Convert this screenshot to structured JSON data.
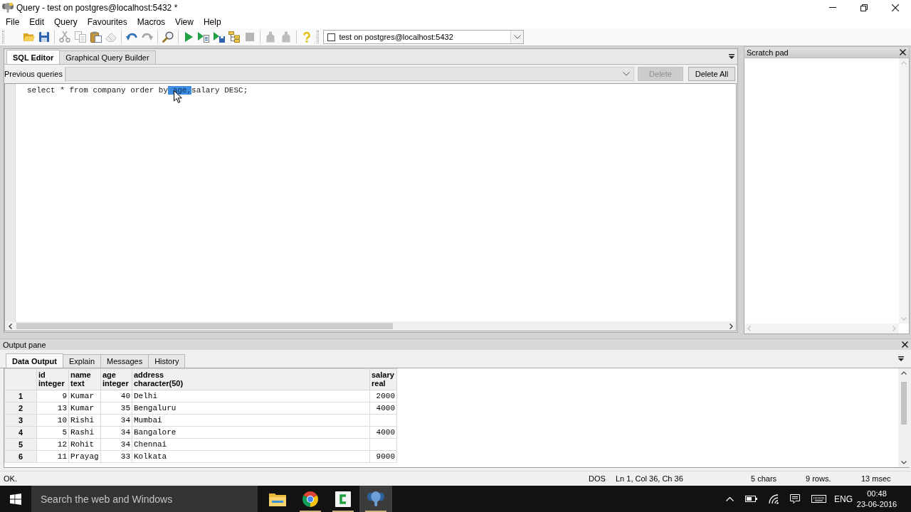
{
  "window": {
    "title": "Query - test on postgres@localhost:5432 *"
  },
  "menu": [
    "File",
    "Edit",
    "Query",
    "Favourites",
    "Macros",
    "View",
    "Help"
  ],
  "toolbar": {
    "tools": [
      {
        "kind": "open",
        "disabled": false
      },
      {
        "kind": "save",
        "disabled": false
      },
      {
        "kind": "separator"
      },
      {
        "kind": "cut",
        "disabled": true
      },
      {
        "kind": "copy",
        "disabled": true
      },
      {
        "kind": "paste",
        "disabled": false
      },
      {
        "kind": "clear",
        "disabled": true
      },
      {
        "kind": "separator"
      },
      {
        "kind": "undo",
        "disabled": false
      },
      {
        "kind": "redo",
        "disabled": true
      },
      {
        "kind": "separator"
      },
      {
        "kind": "find",
        "disabled": false
      },
      {
        "kind": "separator"
      },
      {
        "kind": "execute",
        "disabled": false
      },
      {
        "kind": "execute_pgscript",
        "disabled": false
      },
      {
        "kind": "execute_to_file",
        "disabled": false
      },
      {
        "kind": "explain",
        "disabled": false
      },
      {
        "kind": "cancel",
        "disabled": true
      },
      {
        "kind": "separator"
      },
      {
        "kind": "commit",
        "disabled": true
      },
      {
        "kind": "rollback",
        "disabled": true
      },
      {
        "kind": "separator"
      },
      {
        "kind": "help",
        "disabled": false
      }
    ],
    "connection": {
      "checked": false,
      "label": "test on postgres@localhost:5432"
    }
  },
  "editor": {
    "tabs": [
      {
        "label": "SQL Editor",
        "selected": true
      },
      {
        "label": "Graphical Query Builder",
        "selected": false
      }
    ],
    "previous_queries": {
      "label": "Previous queries"
    },
    "buttons": [
      {
        "label": "Delete",
        "disabled": true
      },
      {
        "label": "Delete All",
        "disabled": false
      }
    ],
    "lines": [
      {
        "segments": [
          {
            "text": "select * from company order by",
            "selected": false
          },
          {
            "text": " age,",
            "selected": true
          },
          {
            "text": "salary DESC;",
            "selected": false
          }
        ]
      }
    ]
  },
  "scratch_pad": {
    "title": "Scratch pad"
  },
  "output_pane": {
    "title": "Output pane",
    "tabs": [
      {
        "label": "Data Output",
        "selected": true
      },
      {
        "label": "Explain",
        "selected": false
      },
      {
        "label": "Messages",
        "selected": false
      },
      {
        "label": "History",
        "selected": false
      }
    ],
    "table": {
      "columns": [
        {
          "name": "id",
          "type": "integer",
          "numeric": true
        },
        {
          "name": "name",
          "type": "text",
          "numeric": false
        },
        {
          "name": "age",
          "type": "integer",
          "numeric": true
        },
        {
          "name": "address",
          "type": "character(50)",
          "numeric": false
        },
        {
          "name": "salary",
          "type": "real",
          "numeric": true
        }
      ],
      "rows": [
        {
          "number": "1",
          "cells": [
            "9",
            "Kumar",
            "40",
            "Delhi",
            "2000"
          ]
        },
        {
          "number": "2",
          "cells": [
            "13",
            "Kumar",
            "35",
            "Bengaluru",
            "4000"
          ]
        },
        {
          "number": "3",
          "cells": [
            "10",
            "Rishi",
            "34",
            "Mumbai",
            null
          ]
        },
        {
          "number": "4",
          "cells": [
            "5",
            "Rashi",
            "34",
            "Bangalore",
            "4000"
          ]
        },
        {
          "number": "5",
          "cells": [
            "12",
            "Rohit",
            "34",
            "Chennai",
            null
          ]
        },
        {
          "number": "6",
          "cells": [
            "11",
            "Prayag",
            "33",
            "Kolkata",
            "9000"
          ]
        }
      ]
    }
  },
  "status_bar": {
    "message": "OK.",
    "line_ending": "DOS",
    "cursor": "Ln 1, Col 36, Ch 36",
    "selection": "5 chars",
    "rows": "9 rows.",
    "duration": "13 msec"
  },
  "taskbar": {
    "search": {
      "placeholder": "Search the web and Windows"
    },
    "apps": [
      {
        "kind": "file_explorer",
        "running": false,
        "selected": false
      },
      {
        "kind": "chrome",
        "running": true,
        "selected": false
      },
      {
        "kind": "camtasia",
        "running": true,
        "selected": false
      },
      {
        "kind": "pgadmin",
        "running": true,
        "selected": true
      }
    ],
    "tray": {
      "language": "ENG",
      "time": "00:48",
      "date": "23-06-2016"
    }
  }
}
